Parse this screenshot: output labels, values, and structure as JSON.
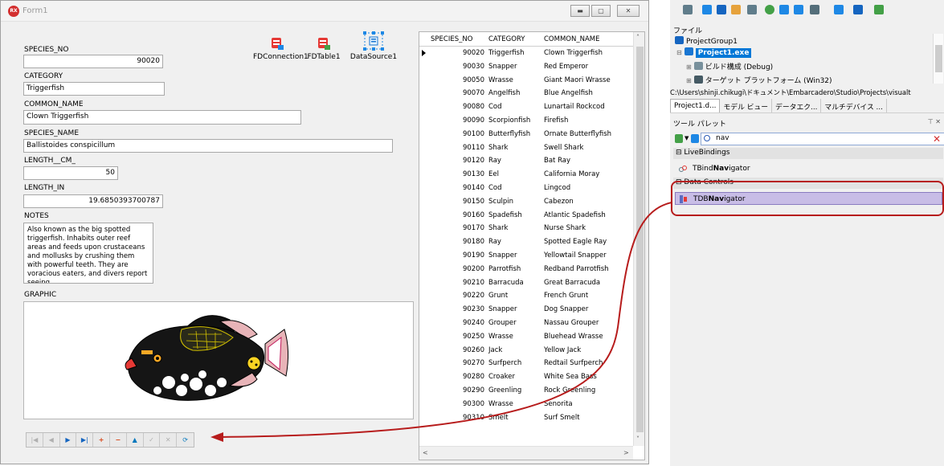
{
  "form": {
    "title": "Form1",
    "icon_text": "RX",
    "fields": {
      "species_no": {
        "label": "SPECIES_NO",
        "value": "90020"
      },
      "category": {
        "label": "CATEGORY",
        "value": "Triggerfish"
      },
      "common_name": {
        "label": "COMMON_NAME",
        "value": "Clown Triggerfish"
      },
      "species_name": {
        "label": "SPECIES_NAME",
        "value": "Ballistoides conspicillum"
      },
      "length_cm": {
        "label": "LENGTH__CM_",
        "value": "50"
      },
      "length_in": {
        "label": "LENGTH_IN",
        "value": "19.6850393700787"
      },
      "notes": {
        "label": "NOTES",
        "value": "Also known as the big spotted triggerfish.  Inhabits outer reef areas and feeds upon crustaceans and mollusks by crushing them with powerful teeth.  They are voracious eaters, and divers report seeing"
      },
      "graphic": {
        "label": "GRAPHIC"
      }
    },
    "components": [
      "FDConnection1",
      "FDTable1",
      "DataSource1"
    ],
    "navigator_buttons": [
      {
        "name": "first",
        "glyph": "|◀"
      },
      {
        "name": "prior",
        "glyph": "◀"
      },
      {
        "name": "next",
        "glyph": "▶"
      },
      {
        "name": "last",
        "glyph": "▶|"
      },
      {
        "name": "insert",
        "glyph": "+"
      },
      {
        "name": "delete",
        "glyph": "−"
      },
      {
        "name": "edit",
        "glyph": "▲"
      },
      {
        "name": "post",
        "glyph": "✓"
      },
      {
        "name": "cancel",
        "glyph": "✕"
      },
      {
        "name": "refresh",
        "glyph": "⟳"
      }
    ]
  },
  "grid": {
    "columns": [
      "SPECIES_NO",
      "CATEGORY",
      "COMMON_NAME"
    ],
    "rows": [
      [
        "90020",
        "Triggerfish",
        "Clown Triggerfish"
      ],
      [
        "90030",
        "Snapper",
        "Red Emperor"
      ],
      [
        "90050",
        "Wrasse",
        "Giant Maori Wrasse"
      ],
      [
        "90070",
        "Angelfish",
        "Blue Angelfish"
      ],
      [
        "90080",
        "Cod",
        "Lunartail Rockcod"
      ],
      [
        "90090",
        "Scorpionfish",
        "Firefish"
      ],
      [
        "90100",
        "Butterflyfish",
        "Ornate Butterflyfish"
      ],
      [
        "90110",
        "Shark",
        "Swell Shark"
      ],
      [
        "90120",
        "Ray",
        "Bat Ray"
      ],
      [
        "90130",
        "Eel",
        "California Moray"
      ],
      [
        "90140",
        "Cod",
        "Lingcod"
      ],
      [
        "90150",
        "Sculpin",
        "Cabezon"
      ],
      [
        "90160",
        "Spadefish",
        "Atlantic Spadefish"
      ],
      [
        "90170",
        "Shark",
        "Nurse Shark"
      ],
      [
        "90180",
        "Ray",
        "Spotted Eagle Ray"
      ],
      [
        "90190",
        "Snapper",
        "Yellowtail Snapper"
      ],
      [
        "90200",
        "Parrotfish",
        "Redband Parrotfish"
      ],
      [
        "90210",
        "Barracuda",
        "Great Barracuda"
      ],
      [
        "90220",
        "Grunt",
        "French Grunt"
      ],
      [
        "90230",
        "Snapper",
        "Dog Snapper"
      ],
      [
        "90240",
        "Grouper",
        "Nassau Grouper"
      ],
      [
        "90250",
        "Wrasse",
        "Bluehead Wrasse"
      ],
      [
        "90260",
        "Jack",
        "Yellow Jack"
      ],
      [
        "90270",
        "Surfperch",
        "Redtail Surfperch"
      ],
      [
        "90280",
        "Croaker",
        "White Sea Bass"
      ],
      [
        "90290",
        "Greenling",
        "Rock Greenling"
      ],
      [
        "90300",
        "Wrasse",
        "Senorita"
      ],
      [
        "90310",
        "Smelt",
        "Surf Smelt"
      ]
    ]
  },
  "ide": {
    "file_label": "ファイル",
    "tree": {
      "group": "ProjectGroup1",
      "project": "Project1.exe",
      "build_config": "ビルド構成 (Debug)",
      "target_platform": "ターゲット プラットフォーム (Win32)"
    },
    "path": "C:\\Users\\shinji.chikugi\\ドキュメント\\Embarcadero\\Studio\\Projects\\visualt",
    "tabs": [
      "Project1.d...",
      "モデル ビュー",
      "データエク...",
      "マルチデバイス ..."
    ],
    "tool_palette": {
      "title": "ツール パレット",
      "search": "nav",
      "categories": [
        {
          "name": "LiveBindings",
          "items": [
            {
              "prefix": "TBind",
              "highlight": "Nav",
              "suffix": "igator"
            }
          ]
        },
        {
          "name": "Data Controls",
          "items": [
            {
              "prefix": "TDB",
              "highlight": "Nav",
              "suffix": "igator"
            }
          ]
        }
      ]
    }
  },
  "colors": {
    "annotation": "#b71c1c",
    "selection": "#0078d7",
    "highlight_item": "#c8bde6"
  }
}
